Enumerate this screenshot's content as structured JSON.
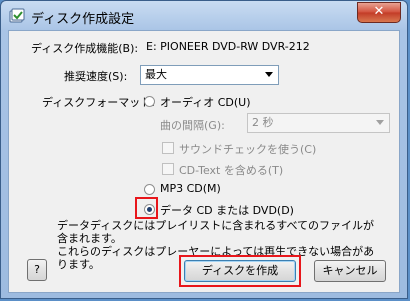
{
  "window": {
    "title": "ディスク作成設定",
    "close_label": "✕"
  },
  "drive": {
    "label": "ディスク作成機能(B):",
    "value": "E: PIONEER DVD-RW  DVR-212"
  },
  "speed": {
    "label": "推奨速度(S):",
    "value": "最大"
  },
  "format": {
    "label": "ディスクフォーマット:",
    "audio_cd": "オーディオ CD(U)",
    "gap_label": "曲の間隔(G):",
    "gap_value": "2 秒",
    "sound_check": "サウンドチェックを使う(C)",
    "cd_text": "CD-Text を含める(T)",
    "mp3_cd": "MP3 CD(M)",
    "data_cd": "データ CD または DVD(D)",
    "selected": "data_cd"
  },
  "description": [
    "データディスクにはプレイリストに含まれるすべてのファイルが含まれます。",
    "これらのディスクはプレーヤーによっては再生できない場合があります。"
  ],
  "buttons": {
    "help": "?",
    "burn": "ディスクを作成",
    "cancel": "キャンセル"
  },
  "colors": {
    "highlight": "#e8161b",
    "title_bar": "#a9c4e6",
    "close_button": "#c23b27"
  }
}
